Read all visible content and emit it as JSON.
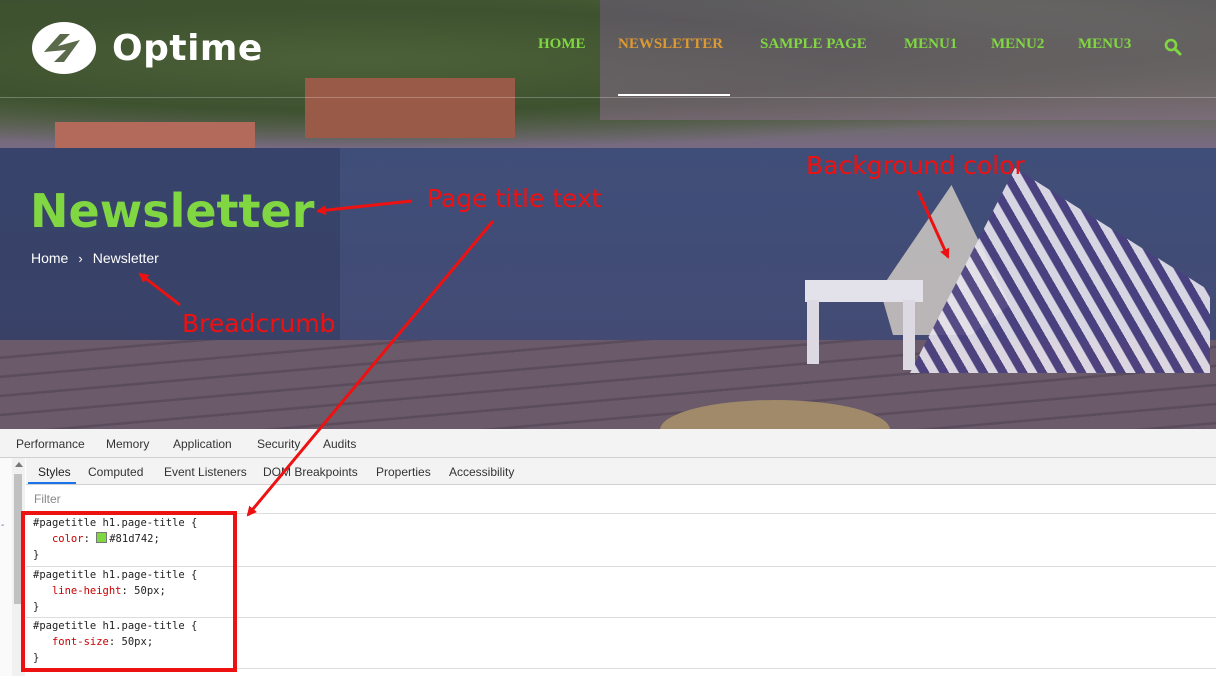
{
  "site": {
    "logo_text": "Optime",
    "nav": [
      "HOME",
      "NEWSLETTER",
      "SAMPLE PAGE",
      "MENU1",
      "MENU2",
      "MENU3"
    ],
    "active_nav": "NEWSLETTER",
    "page_title": "Newsletter",
    "breadcrumb": {
      "home": "Home",
      "separator": "›",
      "current": "Newsletter"
    }
  },
  "annotations": {
    "page_title_text": "Page title text",
    "background_color": "Background color",
    "breadcrumb": "Breadcrumb"
  },
  "devtools": {
    "main_tabs": [
      "Performance",
      "Memory",
      "Application",
      "Security",
      "Audits"
    ],
    "sub_tabs": [
      "Styles",
      "Computed",
      "Event Listeners",
      "DOM Breakpoints",
      "Properties",
      "Accessibility"
    ],
    "active_sub_tab": "Styles",
    "filter_placeholder": "Filter",
    "rules": [
      {
        "selector": "#pagetitle h1.page-title {",
        "property": "color",
        "value": "#81d742;",
        "closing": "}"
      },
      {
        "selector": "#pagetitle h1.page-title {",
        "property": "line-height",
        "value": "50px;",
        "closing": "}"
      },
      {
        "selector": "#pagetitle h1.page-title {",
        "property": "font-size",
        "value": "50px;",
        "closing": "}"
      }
    ]
  },
  "colors": {
    "title_green": "#81d742",
    "nav_active": "#dd9933",
    "annotation_red": "#ee1111"
  }
}
